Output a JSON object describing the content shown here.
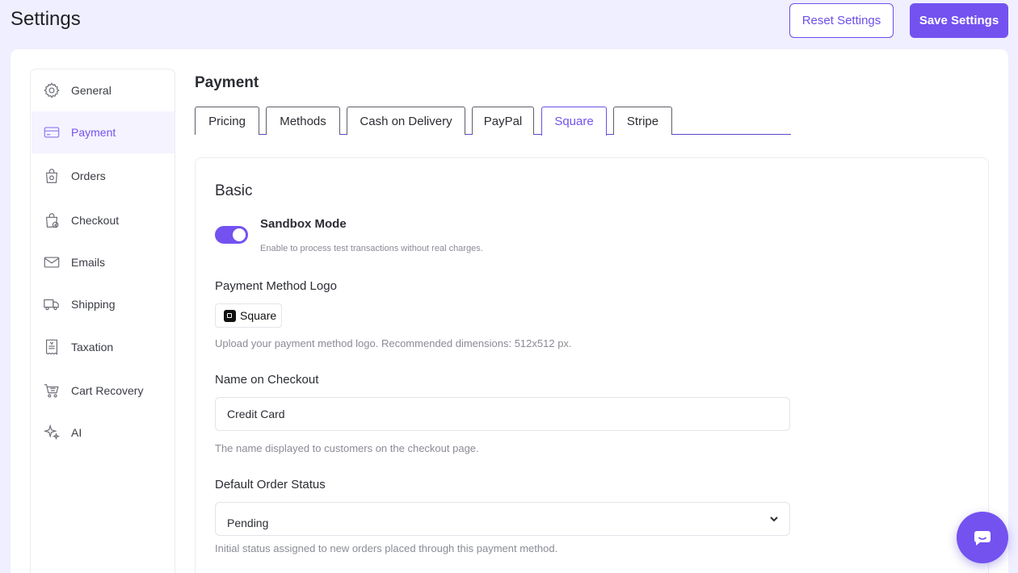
{
  "header": {
    "title": "Settings",
    "reset_label": "Reset Settings",
    "save_label": "Save Settings"
  },
  "sidebar": {
    "items": [
      {
        "label": "General",
        "icon": "gear-icon"
      },
      {
        "label": "Payment",
        "icon": "credit-card-icon",
        "active": true
      },
      {
        "label": "Orders",
        "icon": "shopping-bag-icon"
      },
      {
        "label": "Checkout",
        "icon": "bag-check-icon"
      },
      {
        "label": "Emails",
        "icon": "envelope-icon"
      },
      {
        "label": "Shipping",
        "icon": "truck-icon"
      },
      {
        "label": "Taxation",
        "icon": "receipt-icon"
      },
      {
        "label": "Cart Recovery",
        "icon": "cart-icon"
      },
      {
        "label": "AI",
        "icon": "sparkles-icon"
      }
    ]
  },
  "main": {
    "section_title": "Payment",
    "tabs": [
      {
        "label": "Pricing"
      },
      {
        "label": "Methods"
      },
      {
        "label": "Cash on Delivery"
      },
      {
        "label": "PayPal"
      },
      {
        "label": "Square",
        "active": true
      },
      {
        "label": "Stripe"
      }
    ],
    "basic": {
      "heading": "Basic",
      "sandbox": {
        "label": "Sandbox Mode",
        "description": "Enable to process test transactions without real charges.",
        "enabled": true
      },
      "logo": {
        "label": "Payment Method Logo",
        "logo_text": "Square",
        "help": "Upload your payment method logo. Recommended dimensions: 512x512 px."
      },
      "name_on_checkout": {
        "label": "Name on Checkout",
        "value": "Credit Card",
        "help": "The name displayed to customers on the checkout page."
      },
      "default_order_status": {
        "label": "Default Order Status",
        "value": "Pending",
        "help": "Initial status assigned to new orders placed through this payment method."
      }
    }
  },
  "colors": {
    "accent": "#7352f0",
    "background": "#efefff"
  }
}
